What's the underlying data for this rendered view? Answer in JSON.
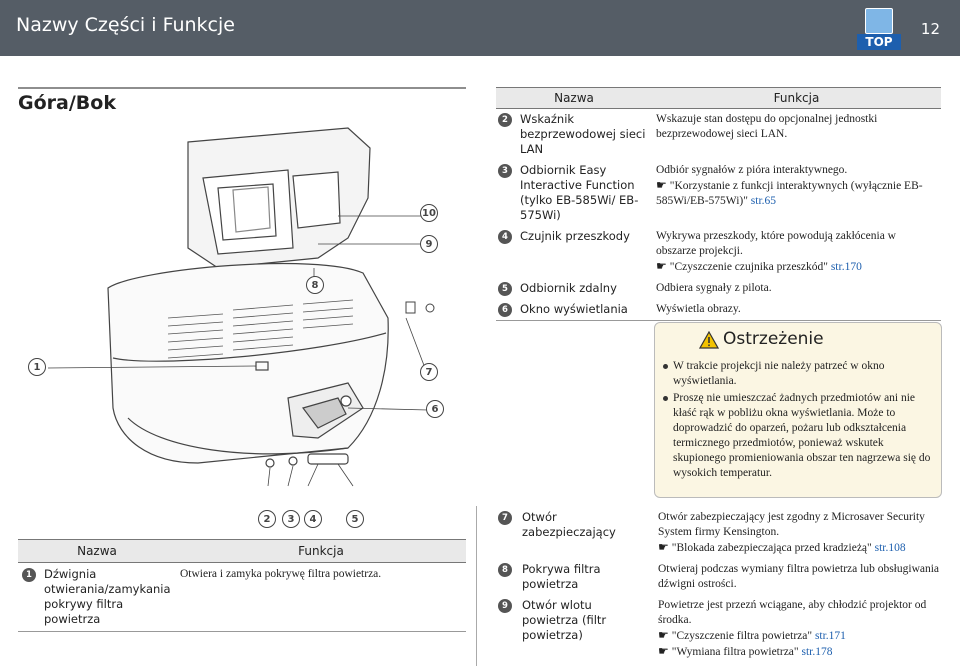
{
  "header": {
    "title": "Nazwy Części i Funkcje",
    "page": "12",
    "top_label": "TOP"
  },
  "section": {
    "title": "Góra/Bok"
  },
  "callouts": {
    "c1": "1",
    "c2": "2",
    "c3": "3",
    "c4": "4",
    "c5": "5",
    "c6": "6",
    "c7": "7",
    "c8": "8",
    "c9": "9",
    "c10": "10"
  },
  "table": {
    "col_name": "Nazwa",
    "col_function": "Funkcja",
    "rows": [
      {
        "num": "2",
        "name": "Wskaźnik bezprzewodowej sieci LAN",
        "function": "Wskazuje stan dostępu do opcjonalnej jednostki bezprzewodowej sieci LAN."
      },
      {
        "num": "3",
        "name": "Odbiornik Easy Interactive Function (tylko EB-585Wi/ EB-575Wi)",
        "function": "Odbiór sygnałów z pióra interaktywnego.",
        "ref_text": "\"Korzystanie z funkcji interaktywnych (wyłącznie EB-585Wi/EB-575Wi)\"",
        "ref_page": "str.65"
      },
      {
        "num": "4",
        "name": "Czujnik przeszkody",
        "function": "Wykrywa przeszkody, które powodują zakłócenia w obszarze projekcji.",
        "ref_text": "\"Czyszczenie czujnika przeszkód\"",
        "ref_page": "str.170"
      },
      {
        "num": "5",
        "name": "Odbiornik zdalny",
        "function": "Odbiera sygnały z pilota."
      },
      {
        "num": "6",
        "name": "Okno wyświetlania",
        "function": "Wyświetla obrazy."
      }
    ]
  },
  "caution": {
    "title": "Ostrzeżenie",
    "items": [
      "W trakcie projekcji nie należy patrzeć w okno wyświetlania.",
      "Proszę nie umieszczać żadnych przedmiotów ani nie kłaść rąk w pobliżu okna wyświetlania. Może to doprowadzić do oparzeń, pożaru lub odkształcenia termicznego przedmiotów, ponieważ wskutek skupionego promieniowania obszar ten nagrzewa się do wysokich temperatur."
    ]
  },
  "bottom_table": {
    "col_name": "Nazwa",
    "col_function": "Funkcja",
    "rows": [
      {
        "num": "1",
        "name": "Dźwignia otwierania/zamykania pokrywy filtra powietrza",
        "function": "Otwiera i zamyka pokrywę filtra powietrza."
      }
    ]
  },
  "bottom_rows": [
    {
      "num": "7",
      "name": "Otwór zabezpieczający",
      "function": "Otwór zabezpieczający jest zgodny z Microsaver Security System firmy Kensington.",
      "ref_text": "\"Blokada zabezpieczająca przed kradzieżą\"",
      "ref_page": "str.108"
    },
    {
      "num": "8",
      "name": "Pokrywa filtra powietrza",
      "function": "Otwieraj podczas wymiany filtra powietrza lub obsługiwania dźwigni ostrości."
    },
    {
      "num": "9",
      "name": "Otwór wlotu powietrza (filtr powietrza)",
      "function": "Powietrze jest przezń wciągane, aby chłodzić projektor od środka.",
      "ref_text": "\"Czyszczenie filtra powietrza\"",
      "ref_page": "str.171",
      "ref2_text": "\"Wymiana filtra powietrza\"",
      "ref2_page": "str.178"
    }
  ],
  "colors": {
    "header_bg": "#555d66",
    "link": "#1d5fae",
    "caution_bg": "#fbf6e3"
  }
}
